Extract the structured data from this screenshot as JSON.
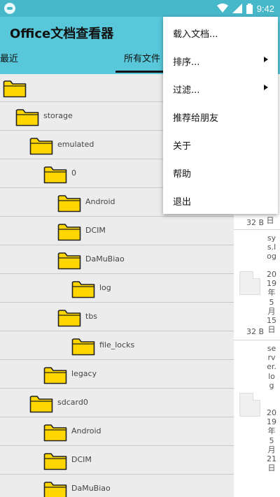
{
  "status_bar": {
    "time": "9:42",
    "icons": [
      "app-icon",
      "wifi-icon",
      "signal-icon",
      "battery-icon"
    ]
  },
  "app_bar": {
    "title": "Office文档查看器"
  },
  "tabs": [
    {
      "label": "最近"
    },
    {
      "label": "所有文件",
      "selected": true
    }
  ],
  "tree": {
    "rows": [
      {
        "label": ""
      },
      {
        "label": "storage"
      },
      {
        "label": "emulated"
      },
      {
        "label": "0"
      },
      {
        "label": "Android"
      },
      {
        "label": "DCIM"
      },
      {
        "label": "DaMuBiao"
      },
      {
        "label": "log"
      },
      {
        "label": "tbs"
      },
      {
        "label": "file_locks"
      },
      {
        "label": "legacy"
      },
      {
        "label": "sdcard0"
      },
      {
        "label": "Android"
      },
      {
        "label": "DCIM"
      },
      {
        "label": "DaMuBiao"
      }
    ]
  },
  "right_pane": {
    "card1_partial": {
      "date_tail": "20日",
      "size": "32 B"
    },
    "card2": {
      "name": "sys.log",
      "date": "2019年5月15日",
      "size": "32 B"
    },
    "card3": {
      "name": "server.log",
      "date": "2019年5月21日"
    }
  },
  "menu": {
    "items": [
      {
        "label": "载入文档..."
      },
      {
        "label": "排序...",
        "submenu": true
      },
      {
        "label": "过滤...",
        "submenu": true
      },
      {
        "label": "推荐给朋友"
      },
      {
        "label": "关于"
      },
      {
        "label": "帮助"
      },
      {
        "label": "退出"
      }
    ]
  },
  "colors": {
    "status_bar": "#47b8c9",
    "app_bar": "#57c7d9",
    "folder_fill": "#ffd600",
    "tree_bg": "#ececec"
  }
}
